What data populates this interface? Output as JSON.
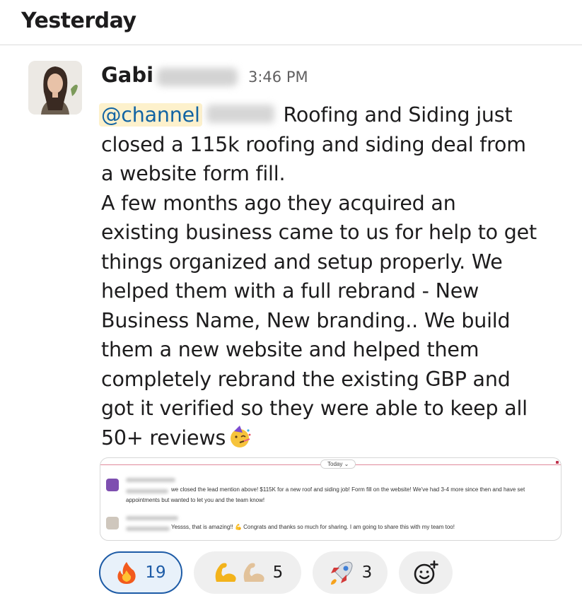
{
  "day_header": {
    "label": "Yesterday"
  },
  "message": {
    "sender": "Gabi",
    "timestamp": "3:46 PM",
    "mention": "@channel",
    "lines": [
      " Roofing and Siding just",
      "closed a 115k roofing and siding deal from",
      "a website form fill.",
      "A few months ago they acquired an",
      "existing business came to us for help to get",
      "things organized and setup properly. We",
      "helped them with a full rebrand - New",
      "Business Name, New branding.. We build",
      "them a new website and helped them",
      "completely rebrand the existing GBP and",
      "got it verified so they were able to keep all",
      "50+ reviews"
    ],
    "end_emoji": "partying-face-emoji"
  },
  "embed": {
    "divider_label": "Today ⌄",
    "msg1_line1": " we closed the lead mention above! $115K for a new roof and siding job! Form fill on the website! We've had 3-4 more since then and have set",
    "msg1_line2": "appointments but wanted to let you and the team know!",
    "msg2_text": " Yessss, that is amazing!! 💪 Congrats and thanks so much for sharing. I am going to share this with my team too!"
  },
  "reactions": [
    {
      "emoji": "fire-emoji",
      "count": "19",
      "active": true
    },
    {
      "emoji": "flexed-biceps-emoji",
      "count": "5",
      "active": false
    },
    {
      "emoji": "rocket-emoji",
      "count": "3",
      "active": false
    },
    {
      "emoji": "add-reaction-icon",
      "count": "",
      "active": false
    }
  ],
  "colors": {
    "mention_bg": "#fdf1cc",
    "mention_text": "#1264a3",
    "active_reaction_border": "#1d5ba6",
    "reaction_bg": "#efefef"
  }
}
